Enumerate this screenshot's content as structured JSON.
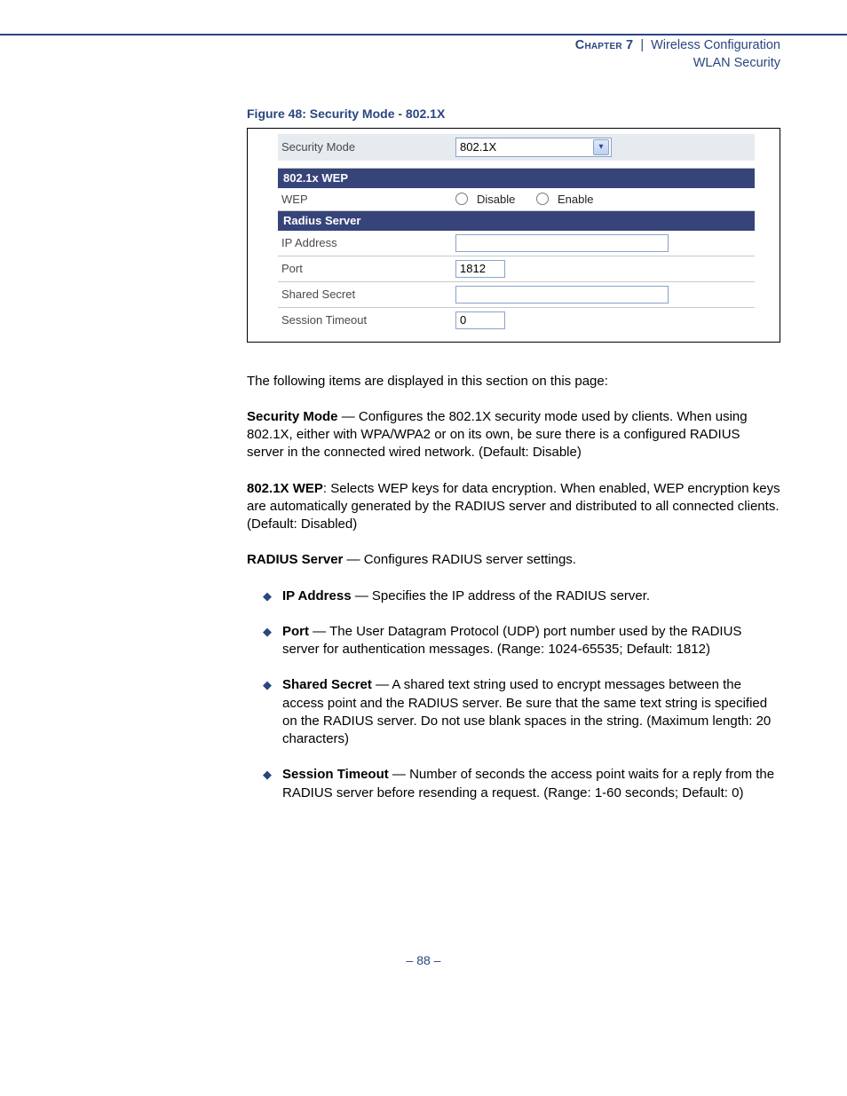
{
  "header": {
    "chapter": "Chapter 7",
    "sep": "|",
    "title": "Wireless Configuration",
    "sub": "WLAN Security"
  },
  "figure": {
    "caption": "Figure 48:  Security Mode - 802.1X",
    "security_mode_label": "Security Mode",
    "security_mode_value": "802.1X",
    "section_wep": "802.1x WEP",
    "wep_label": "WEP",
    "wep_opt_disable": "Disable",
    "wep_opt_enable": "Enable",
    "section_radius": "Radius Server",
    "ip_label": "IP Address",
    "ip_value": "",
    "port_label": "Port",
    "port_value": "1812",
    "secret_label": "Shared Secret",
    "secret_value": "",
    "timeout_label": "Session Timeout",
    "timeout_value": "0"
  },
  "body": {
    "intro": "The following items are displayed in this section on this page:",
    "sec_mode_b": "Security Mode",
    "sec_mode_txt": " — Configures the 802.1X security mode used by clients. When using 802.1X, either with WPA/WPA2 or on its own, be sure there is a configured RADIUS server in the connected wired network. (Default: Disable)",
    "wep_b": "802.1X WEP",
    "wep_txt": ": Selects WEP keys for data encryption. When enabled, WEP encryption keys are automatically generated by the RADIUS server and distributed to all connected clients. (Default: Disabled)",
    "radius_b": "RADIUS Server",
    "radius_txt": " — Configures RADIUS server settings.",
    "li_ip_b": "IP Address",
    "li_ip_txt": " — Specifies the IP address of the RADIUS server.",
    "li_port_b": "Port",
    "li_port_txt": " — The User Datagram Protocol (UDP) port number used by the RADIUS server for authentication messages. (Range: 1024-65535; Default: 1812)",
    "li_secret_b": "Shared Secret",
    "li_secret_txt": " — A shared text string used to encrypt messages between the access point and the RADIUS server. Be sure that the same text string is specified on the RADIUS server. Do not use blank spaces in the string. (Maximum length: 20 characters)",
    "li_timeout_b": "Session Timeout",
    "li_timeout_txt": " — Number of seconds the access point waits for a reply from the RADIUS server before resending a request. (Range: 1-60 seconds; Default: 0)"
  },
  "footer": {
    "page": "–  88  –"
  }
}
